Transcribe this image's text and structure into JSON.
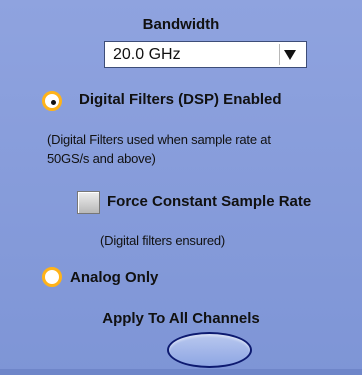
{
  "bandwidth": {
    "title": "Bandwidth",
    "selected_value": "20.0 GHz"
  },
  "dsp_option": {
    "label": "Digital Filters (DSP) Enabled",
    "selected": true,
    "note_line1": "(Digital Filters used when sample rate at",
    "note_line2": "50GS/s and above)"
  },
  "force_constant": {
    "label": "Force Constant Sample Rate",
    "checked": false,
    "note": "(Digital filters ensured)"
  },
  "analog_option": {
    "label": "Analog Only",
    "selected": false
  },
  "apply": {
    "label": "Apply To All Channels"
  },
  "colors": {
    "panel_background": "#8fa3df",
    "radio_accent": "#ffb319",
    "button_fill": "#a9bbea",
    "button_border": "#0d1a70"
  },
  "icons": {
    "dropdown": "chevron-down-icon",
    "selected_radio": "radio-selected-icon",
    "unselected_radio": "radio-unselected-icon"
  }
}
